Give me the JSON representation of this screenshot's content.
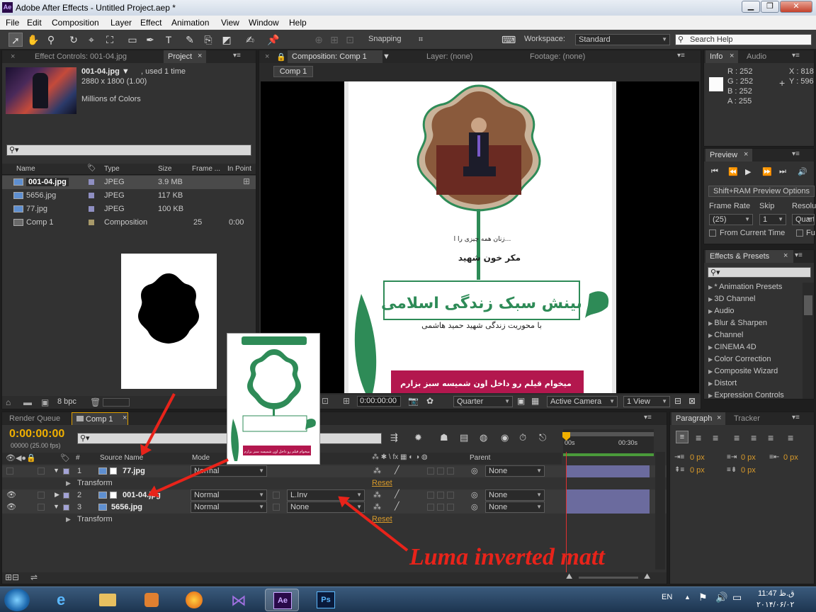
{
  "window": {
    "title": "Adobe After Effects - Untitled Project.aep *",
    "app_logo": "Ae",
    "controls": [
      "minimize",
      "maximize",
      "close"
    ]
  },
  "menu": [
    "File",
    "Edit",
    "Composition",
    "Layer",
    "Effect",
    "Animation",
    "View",
    "Window",
    "Help"
  ],
  "toolbar": {
    "snapping_label": "Snapping",
    "workspace_label": "Workspace:",
    "workspace_value": "Standard",
    "search_help_placeholder": "Search Help"
  },
  "project_panel": {
    "tabs": [
      "Effect Controls: 001-04.jpg",
      "Project"
    ],
    "active_tab": "Project",
    "item_name": "001-04.jpg ▼",
    "item_used": ", used 1 time",
    "item_size": "2880 x 1800 (1.00)",
    "item_colors": "Millions of Colors",
    "search_placeholder": "",
    "columns": [
      "Name",
      "Type",
      "Size",
      "Frame ...",
      "In Point"
    ],
    "items": [
      {
        "name": "001-04.jpg",
        "type": "JPEG",
        "size": "3.9 MB",
        "frame": "",
        "inpoint": "",
        "color": "#8f8fc2"
      },
      {
        "name": "5656.jpg",
        "type": "JPEG",
        "size": "117 KB",
        "frame": "",
        "inpoint": "",
        "color": "#8f8fc2"
      },
      {
        "name": "77.jpg",
        "type": "JPEG",
        "size": "100 KB",
        "frame": "",
        "inpoint": "",
        "color": "#8f8fc2"
      },
      {
        "name": "Comp 1",
        "type": "Composition",
        "size": "",
        "frame": "25",
        "inpoint": "0:00",
        "color": "#a89a6a"
      }
    ],
    "bpc": "8 bpc"
  },
  "comp_panel": {
    "tabs": [
      "Composition: Comp 1",
      "Layer: (none)",
      "Footage: (none)"
    ],
    "breadcrumb": "Comp 1",
    "timecode": "0:00:00:00",
    "resolution": "Quarter",
    "camera": "Active Camera",
    "views": "1 View",
    "poster": {
      "headline_line1": "بینش سبک زندگی اسلامی",
      "subtitle": "با محوریت زندگی شهید حمید هاشمی",
      "caption_top": "زنان همه چیزی را ا...",
      "caption_mid": "مکر خون شهید",
      "banner": "میخوام قیلم رو داخل اون شمیسه سبز بزارم"
    }
  },
  "info_panel": {
    "tabs": [
      "Info",
      "Audio"
    ],
    "R": "R : 252",
    "G": "G : 252",
    "B": "B : 252",
    "A": "A : 255",
    "X": "X : 818",
    "Y": "Y : 596"
  },
  "preview_panel": {
    "tab": "Preview",
    "ram_options": "Shift+RAM Preview Options",
    "frame_rate_label": "Frame Rate",
    "skip_label": "Skip",
    "resolution_label": "Resolu",
    "frame_rate": "(25)",
    "skip": "1",
    "resolution": "Quart",
    "from_current": "From Current Time",
    "full": "Fu"
  },
  "effects_panel": {
    "tab": "Effects & Presets",
    "search_placeholder": "",
    "items": [
      "* Animation Presets",
      "3D Channel",
      "Audio",
      "Blur & Sharpen",
      "Channel",
      "CINEMA 4D",
      "Color Correction",
      "Composite Wizard",
      "Distort",
      "Expression Controls"
    ]
  },
  "timeline": {
    "tabs": [
      "Render Queue",
      "Comp 1"
    ],
    "timecode": "0:00:00:00",
    "fps": "00000 (25.00 fps)",
    "ruler": [
      "00s",
      "00:30s"
    ],
    "columns": {
      "num": "#",
      "source": "Source Name",
      "mode": "Mode",
      "parent": "Parent"
    },
    "layers": [
      {
        "num": "1",
        "name": "77.jpg",
        "mode": "Normal",
        "trkmat": "",
        "parent": "None",
        "sub": "Transform",
        "reset": "Reset",
        "expanded": true
      },
      {
        "num": "2",
        "name": "001-04.jpg",
        "mode": "Normal",
        "trkmat": "L.Inv",
        "parent": "None",
        "sub": "",
        "reset": "",
        "expanded": false
      },
      {
        "num": "3",
        "name": "5656.jpg",
        "mode": "Normal",
        "trkmat": "None",
        "parent": "None",
        "sub": "Transform",
        "reset": "Reset",
        "expanded": true
      }
    ]
  },
  "paragraph_panel": {
    "tabs": [
      "Paragraph",
      "Tracker"
    ],
    "values": [
      "0 px",
      "0 px",
      "0 px",
      "0 px",
      "0 px"
    ]
  },
  "annotation": {
    "text": "Luma inverted matt",
    "overlay_poster_banner": "میخوام قیلم رو داخل اون شمیسه سبز بزارم"
  },
  "taskbar": {
    "lang": "EN",
    "time": "11:47 ق.ظ",
    "date": "۲۰۱۴/۰۶/۰۲"
  }
}
